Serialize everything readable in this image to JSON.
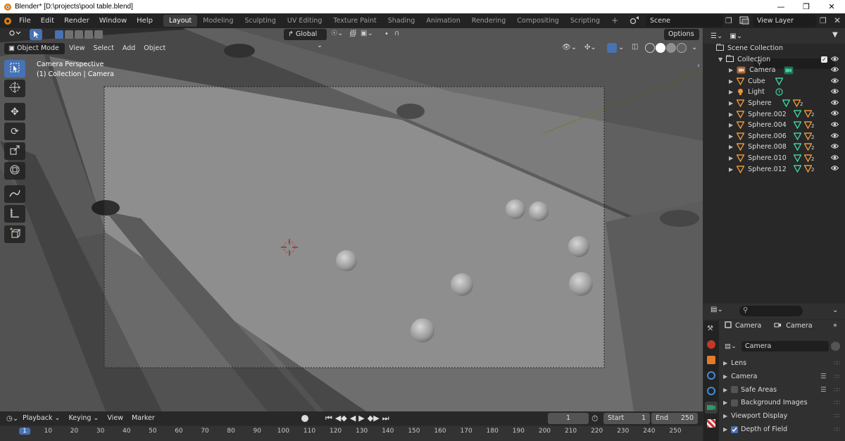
{
  "window": {
    "title": "Blender* [D:\\projects\\pool table.blend]"
  },
  "menu": {
    "items": [
      "File",
      "Edit",
      "Render",
      "Window",
      "Help"
    ]
  },
  "workspaces": {
    "tabs": [
      "Layout",
      "Modeling",
      "Sculpting",
      "UV Editing",
      "Texture Paint",
      "Shading",
      "Animation",
      "Rendering",
      "Compositing",
      "Scripting"
    ],
    "active": "Layout"
  },
  "scene": {
    "name": "Scene",
    "view_layer": "View Layer"
  },
  "viewport": {
    "transform_orientation": "Global",
    "options_label": "Options",
    "mode": "Object Mode",
    "menus": [
      "View",
      "Select",
      "Add",
      "Object"
    ],
    "overlay_line1": "Camera Perspective",
    "overlay_line2": "(1) Collection | Camera",
    "colors": {
      "table": "#8e8e8e",
      "rail": "#6f6f6f",
      "background": "#3a3a3a"
    }
  },
  "outliner": {
    "root": "Scene Collection",
    "collection": "Collection",
    "items": [
      {
        "name": "Camera",
        "icon": "camera-icon"
      },
      {
        "name": "Cube",
        "icon": "mesh-icon"
      },
      {
        "name": "Light",
        "icon": "light-icon"
      },
      {
        "name": "Sphere",
        "icon": "mesh-icon",
        "badge": "2"
      },
      {
        "name": "Sphere.002",
        "icon": "mesh-icon",
        "badge": "2"
      },
      {
        "name": "Sphere.004",
        "icon": "mesh-icon",
        "badge": "2"
      },
      {
        "name": "Sphere.006",
        "icon": "mesh-icon",
        "badge": "2"
      },
      {
        "name": "Sphere.008",
        "icon": "mesh-icon",
        "badge": "2"
      },
      {
        "name": "Sphere.010",
        "icon": "mesh-icon",
        "badge": "2"
      },
      {
        "name": "Sphere.012",
        "icon": "mesh-icon",
        "badge": "2"
      }
    ]
  },
  "properties": {
    "breadcrumb_object": "Camera",
    "breadcrumb_data": "Camera",
    "datablock": "Camera",
    "panels": [
      {
        "label": "Lens",
        "checkbox": null
      },
      {
        "label": "Camera",
        "checkbox": null
      },
      {
        "label": "Safe Areas",
        "checkbox": false
      },
      {
        "label": "Background Images",
        "checkbox": false
      },
      {
        "label": "Viewport Display",
        "checkbox": null
      },
      {
        "label": "Depth of Field",
        "checkbox": true
      }
    ]
  },
  "timeline": {
    "menus": [
      "Playback",
      "Keying",
      "View",
      "Marker"
    ],
    "current_frame": "1",
    "start_label": "Start",
    "start": "1",
    "end_label": "End",
    "end": "250",
    "ruler": [
      "1",
      "10",
      "20",
      "30",
      "40",
      "50",
      "60",
      "70",
      "80",
      "90",
      "100",
      "110",
      "120",
      "130",
      "140",
      "150",
      "160",
      "170",
      "180",
      "190",
      "200",
      "210",
      "220",
      "230",
      "240",
      "250"
    ]
  }
}
